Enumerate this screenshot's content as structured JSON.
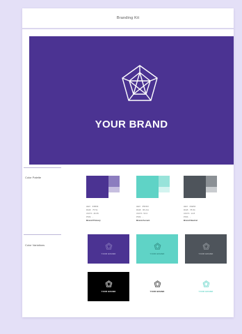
{
  "document": {
    "title": "Branding Kit"
  },
  "hero": {
    "brand_name": "YOUR BRAND"
  },
  "colors": {
    "primary": "#4b3392",
    "teal": "#5fd3c6",
    "slate": "#4e545b",
    "black": "#000000",
    "white": "#ffffff"
  },
  "color_palette": {
    "label": "Color Palette",
    "swatches": [
      {
        "hex": "#4b3392",
        "tint1": "#8c7dbf",
        "tint2": "#c7bfe0",
        "lines": [
          "HEX   #4B39",
          "RGB   75 51",
          "CMYK  46 65",
          "PMS   -"
        ],
        "name": "Brand Primary"
      },
      {
        "hex": "#5fd3c6",
        "tint1": "#98e3da",
        "tint2": "#d3f4f0",
        "lines": [
          "HEX   #5FD3",
          "RGB   95 211",
          "CMYK  53 0",
          "PMS   -"
        ],
        "name": "Brand Accent"
      },
      {
        "hex": "#4e545b",
        "tint1": "#8b9095",
        "tint2": "#c9cccf",
        "lines": [
          "HEX   #4E54",
          "RGB   78 84",
          "CMYK  14 8",
          "PMS   -"
        ],
        "name": "Brand Neutral"
      }
    ]
  },
  "color_variations": {
    "label": "Color Variations",
    "card_text": "YOUR BRAND"
  }
}
